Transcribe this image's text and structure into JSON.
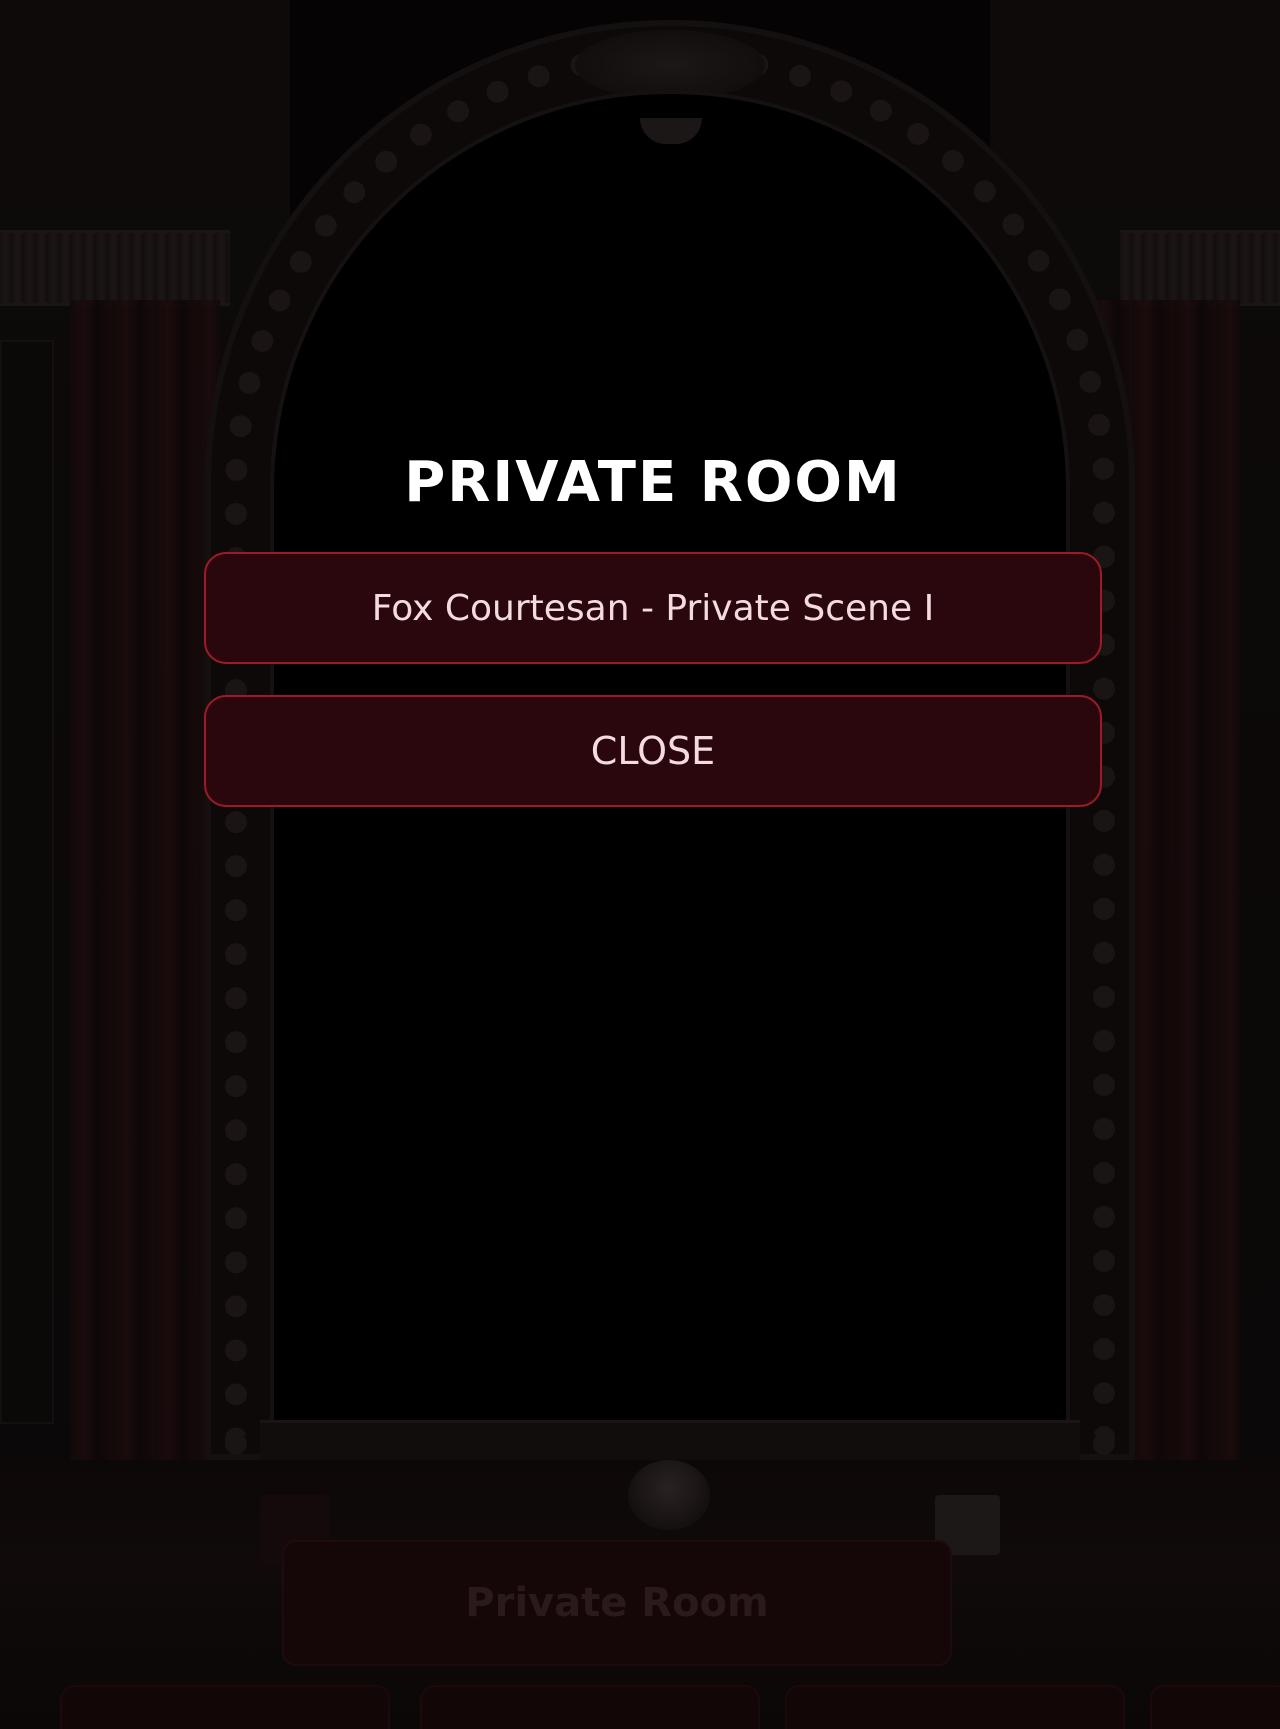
{
  "dialog": {
    "title": "PRIVATE ROOM",
    "options": [
      {
        "label": "Fox Courtesan - Private Scene I"
      }
    ],
    "close_label": "CLOSE"
  },
  "background_ui": {
    "main_button_label": "Private Room"
  },
  "colors": {
    "button_fill": "#2a070c",
    "button_border": "#9e1a2a",
    "title_text": "#ffffff",
    "button_text": "#f3dbe0"
  }
}
